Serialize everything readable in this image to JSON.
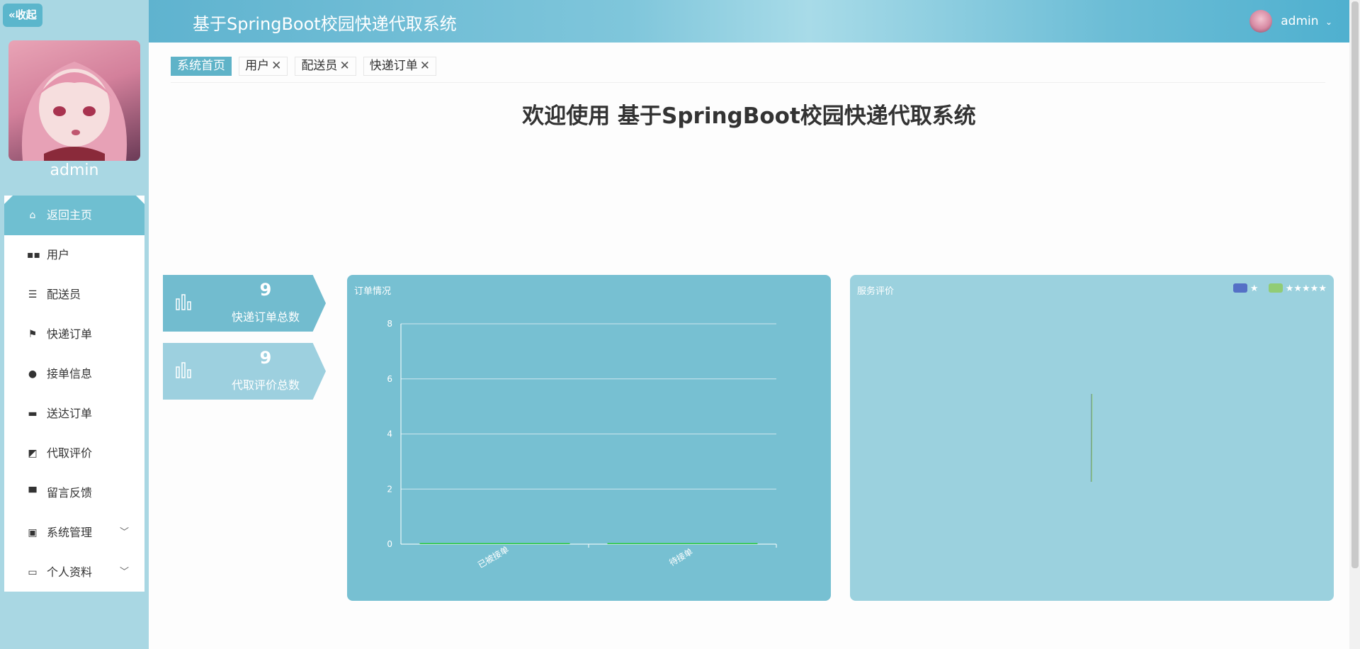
{
  "app": {
    "title": "基于SpringBoot校园快递代取系统",
    "username": "admin"
  },
  "sidebar": {
    "collapse_label": "收起",
    "username": "admin",
    "items": [
      {
        "label": "返回主页",
        "icon": "home-icon"
      },
      {
        "label": "用户",
        "icon": "grid-icon"
      },
      {
        "label": "配送员",
        "icon": "list-icon"
      },
      {
        "label": "快递订单",
        "icon": "flag-icon"
      },
      {
        "label": "接单信息",
        "icon": "user-icon"
      },
      {
        "label": "送达订单",
        "icon": "inbox-icon"
      },
      {
        "label": "代取评价",
        "icon": "chart-icon"
      },
      {
        "label": "留言反馈",
        "icon": "monitor-icon"
      },
      {
        "label": "系统管理",
        "icon": "clipboard-icon"
      },
      {
        "label": "个人资料",
        "icon": "card-icon"
      }
    ]
  },
  "tabs": [
    {
      "label": "系统首页"
    },
    {
      "label": "用户"
    },
    {
      "label": "配送员"
    },
    {
      "label": "快递订单"
    }
  ],
  "main": {
    "welcome": "欢迎使用 基于SpringBoot校园快递代取系统"
  },
  "stats": [
    {
      "value": "9",
      "label": "快递订单总数"
    },
    {
      "value": "9",
      "label": "代取评价总数"
    }
  ],
  "panels": {
    "orders_title": "订单情况",
    "review_title": "服务评价",
    "legend": [
      {
        "label": "★",
        "color": "#5470c6"
      },
      {
        "label": "★★★★★",
        "color": "#91cc75"
      }
    ]
  },
  "chart_data": [
    {
      "type": "bar",
      "title": "订单情况",
      "categories": [
        "已被接单",
        "待接单"
      ],
      "values": [
        0,
        0
      ],
      "ylim": [
        0,
        8
      ],
      "yticks": [
        0,
        2,
        4,
        6,
        8
      ],
      "grid": true,
      "bar_color": "#2ecc40"
    },
    {
      "type": "pie",
      "title": "服务评价",
      "slices": [
        {
          "label": "★",
          "value": 0,
          "color": "#5470c6"
        },
        {
          "label": "★★★★★",
          "value": 0,
          "color": "#91cc75"
        }
      ],
      "legend": "top-right"
    }
  ],
  "colors": {
    "accent": "#5fb3c8",
    "sidebar_bg": "#a9d7e3"
  }
}
